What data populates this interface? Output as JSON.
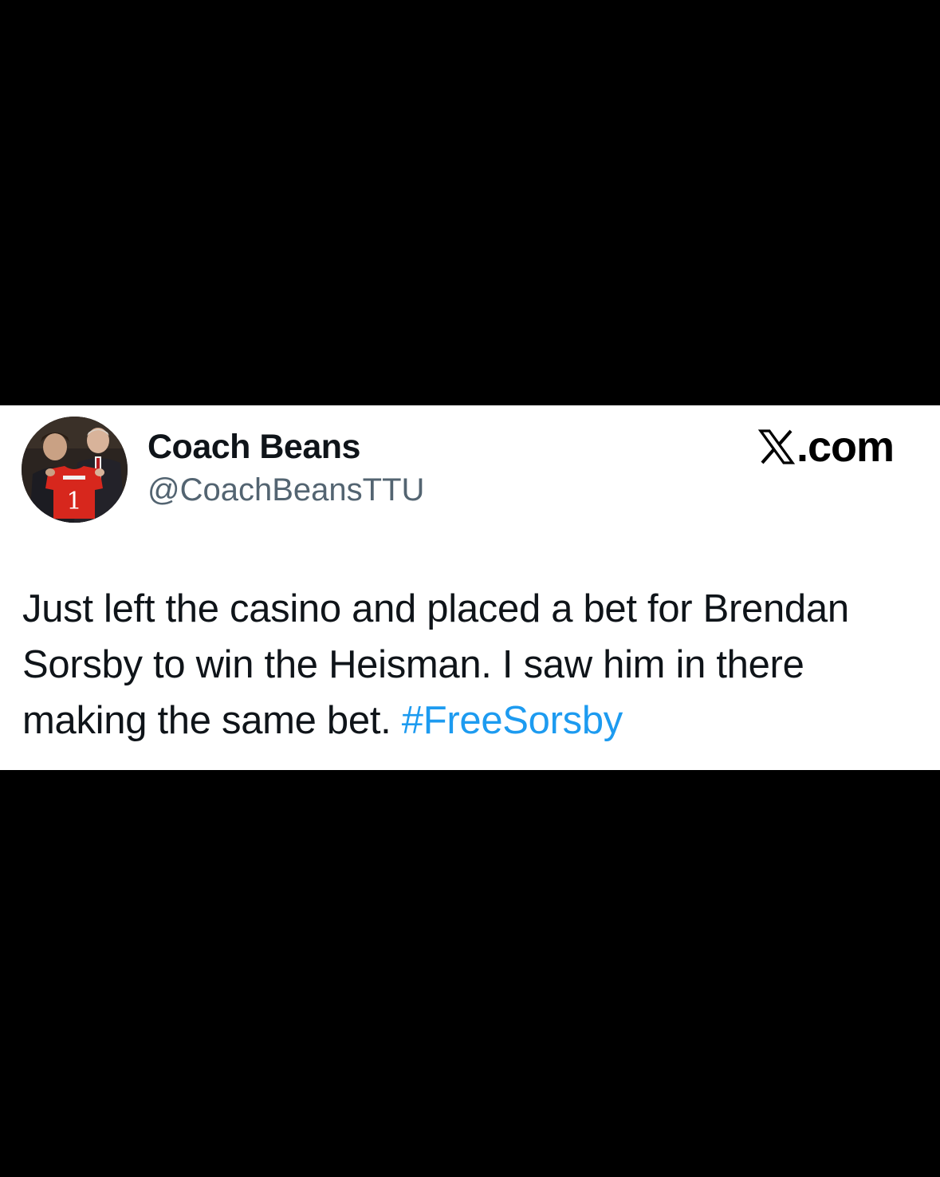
{
  "tweet": {
    "display_name": "Coach Beans",
    "handle": "@CoachBeansTTU",
    "site_label": ".com",
    "site_logo_icon": "x-logo-icon",
    "avatar_icon": "profile-photo",
    "avatar_jersey_number": "1",
    "text_main": "Just left the casino and placed a bet for Brendan Sorsby to win the Heisman. I saw him in there making the same bet. ",
    "hashtag": "#FreeSorsby"
  },
  "colors": {
    "background": "#000000",
    "card": "#ffffff",
    "text": "#0f1419",
    "handle": "#536471",
    "hashtag": "#1d9bf0"
  }
}
